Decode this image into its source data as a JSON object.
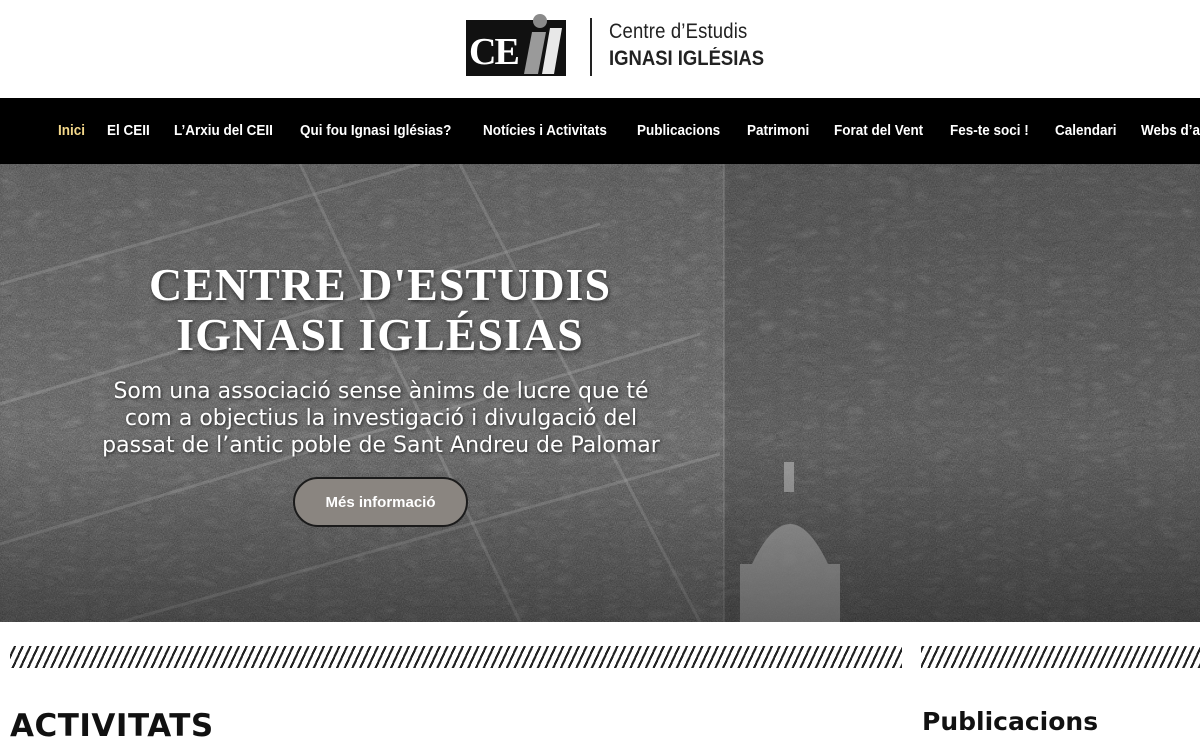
{
  "logo": {
    "mark_text": "CEII",
    "line1": "Centre d’Estudis",
    "line2": "IGNASI IGLÉSIAS"
  },
  "nav": {
    "items": [
      {
        "label": "Inici",
        "active": true
      },
      {
        "label": "El CEII",
        "active": false
      },
      {
        "label": "L’Arxiu del CEII",
        "active": false
      },
      {
        "label": "Qui fou Ignasi Iglésias?",
        "active": false
      },
      {
        "label": "Notícies i Activitats",
        "active": false
      },
      {
        "label": "Publicacions",
        "active": false
      },
      {
        "label": "Patrimoni",
        "active": false
      },
      {
        "label": "Forat del Vent",
        "active": false
      },
      {
        "label": "Fes-te soci !",
        "active": false
      },
      {
        "label": "Calendari",
        "active": false
      },
      {
        "label": "Webs d’amics",
        "active": false
      }
    ]
  },
  "hero": {
    "title_line1": "CENTRE D'ESTUDIS",
    "title_line2": "IGNASI IGLÉSIAS",
    "subtitle_line1": "Som una associació sense ànims de lucre que té",
    "subtitle_line2": "com a objectius la investigació i divulgació del",
    "subtitle_line3": "passat de l’antic poble de Sant Andreu de Palomar",
    "button_label": "Més informació"
  },
  "sections": {
    "activitats": "ACTIVITATS",
    "publicacions": "Publicacions"
  },
  "colors": {
    "nav_bg": "#000000",
    "nav_active": "#f4d88a",
    "button_bg": "#8a8580"
  }
}
